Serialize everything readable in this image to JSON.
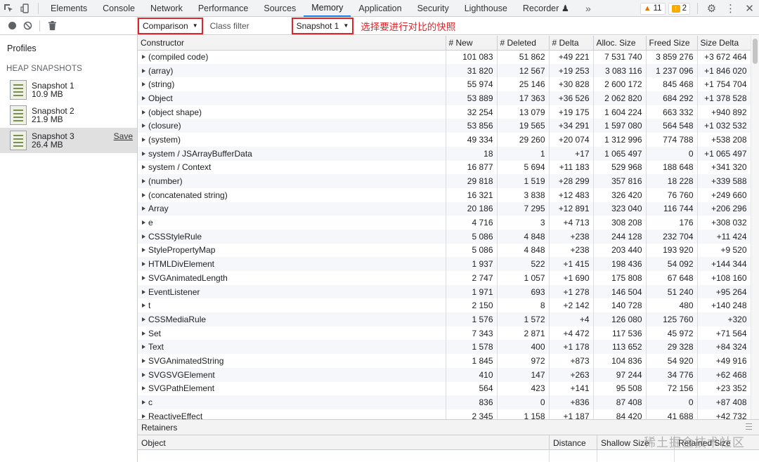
{
  "topbar": {
    "tabs": [
      {
        "label": "Elements"
      },
      {
        "label": "Console"
      },
      {
        "label": "Network"
      },
      {
        "label": "Performance"
      },
      {
        "label": "Sources"
      },
      {
        "label": "Memory"
      },
      {
        "label": "Application"
      },
      {
        "label": "Security"
      },
      {
        "label": "Lighthouse"
      },
      {
        "label": "Recorder ♟"
      }
    ],
    "more": "»",
    "warnings": "11",
    "messages": "2"
  },
  "sidebar": {
    "profiles": "Profiles",
    "heap_header": "HEAP SNAPSHOTS",
    "snapshots": [
      {
        "name": "Snapshot 1",
        "size": "10.9 MB"
      },
      {
        "name": "Snapshot 2",
        "size": "21.9 MB"
      },
      {
        "name": "Snapshot 3",
        "size": "26.4 MB"
      }
    ],
    "save": "Save"
  },
  "toolbar": {
    "view": "Comparison",
    "filter_placeholder": "Class filter",
    "base": "Snapshot 1",
    "annotation": "选择要进行对比的快照"
  },
  "grid": {
    "headers": [
      "Constructor",
      "# New",
      "# Deleted",
      "# Delta",
      "Alloc. Size",
      "Freed Size",
      "Size Delta"
    ],
    "rows": [
      [
        "(compiled code)",
        "101 083",
        "51 862",
        "+49 221",
        "7 531 740",
        "3 859 276",
        "+3 672 464"
      ],
      [
        "(array)",
        "31 820",
        "12 567",
        "+19 253",
        "3 083 116",
        "1 237 096",
        "+1 846 020"
      ],
      [
        "(string)",
        "55 974",
        "25 146",
        "+30 828",
        "2 600 172",
        "845 468",
        "+1 754 704"
      ],
      [
        "Object",
        "53 889",
        "17 363",
        "+36 526",
        "2 062 820",
        "684 292",
        "+1 378 528"
      ],
      [
        "(object shape)",
        "32 254",
        "13 079",
        "+19 175",
        "1 604 224",
        "663 332",
        "+940 892"
      ],
      [
        "(closure)",
        "53 856",
        "19 565",
        "+34 291",
        "1 597 080",
        "564 548",
        "+1 032 532"
      ],
      [
        "(system)",
        "49 334",
        "29 260",
        "+20 074",
        "1 312 996",
        "774 788",
        "+538 208"
      ],
      [
        "system / JSArrayBufferData",
        "18",
        "1",
        "+17",
        "1 065 497",
        "0",
        "+1 065 497"
      ],
      [
        "system / Context",
        "16 877",
        "5 694",
        "+11 183",
        "529 968",
        "188 648",
        "+341 320"
      ],
      [
        "(number)",
        "29 818",
        "1 519",
        "+28 299",
        "357 816",
        "18 228",
        "+339 588"
      ],
      [
        "(concatenated string)",
        "16 321",
        "3 838",
        "+12 483",
        "326 420",
        "76 760",
        "+249 660"
      ],
      [
        "Array",
        "20 186",
        "7 295",
        "+12 891",
        "323 040",
        "116 744",
        "+206 296"
      ],
      [
        "e",
        "4 716",
        "3",
        "+4 713",
        "308 208",
        "176",
        "+308 032"
      ],
      [
        "CSSStyleRule",
        "5 086",
        "4 848",
        "+238",
        "244 128",
        "232 704",
        "+11 424"
      ],
      [
        "StylePropertyMap",
        "5 086",
        "4 848",
        "+238",
        "203 440",
        "193 920",
        "+9 520"
      ],
      [
        "HTMLDivElement",
        "1 937",
        "522",
        "+1 415",
        "198 436",
        "54 092",
        "+144 344"
      ],
      [
        "SVGAnimatedLength",
        "2 747",
        "1 057",
        "+1 690",
        "175 808",
        "67 648",
        "+108 160"
      ],
      [
        "EventListener",
        "1 971",
        "693",
        "+1 278",
        "146 504",
        "51 240",
        "+95 264"
      ],
      [
        "t",
        "2 150",
        "8",
        "+2 142",
        "140 728",
        "480",
        "+140 248"
      ],
      [
        "CSSMediaRule",
        "1 576",
        "1 572",
        "+4",
        "126 080",
        "125 760",
        "+320"
      ],
      [
        "Set",
        "7 343",
        "2 871",
        "+4 472",
        "117 536",
        "45 972",
        "+71 564"
      ],
      [
        "Text",
        "1 578",
        "400",
        "+1 178",
        "113 652",
        "29 328",
        "+84 324"
      ],
      [
        "SVGAnimatedString",
        "1 845",
        "972",
        "+873",
        "104 836",
        "54 920",
        "+49 916"
      ],
      [
        "SVGSVGElement",
        "410",
        "147",
        "+263",
        "97 244",
        "34 776",
        "+62 468"
      ],
      [
        "SVGPathElement",
        "564",
        "423",
        "+141",
        "95 508",
        "72 156",
        "+23 352"
      ],
      [
        "c",
        "836",
        "0",
        "+836",
        "87 408",
        "0",
        "+87 408"
      ],
      [
        "ReactiveEffect",
        "2 345",
        "1 158",
        "+1 187",
        "84 420",
        "41 688",
        "+42 732"
      ]
    ]
  },
  "retainers": {
    "title": "Retainers",
    "headers": [
      "Object",
      "Distance",
      "Shallow Size",
      "Retained Size"
    ]
  },
  "watermark": "稀土掘金技术社区"
}
